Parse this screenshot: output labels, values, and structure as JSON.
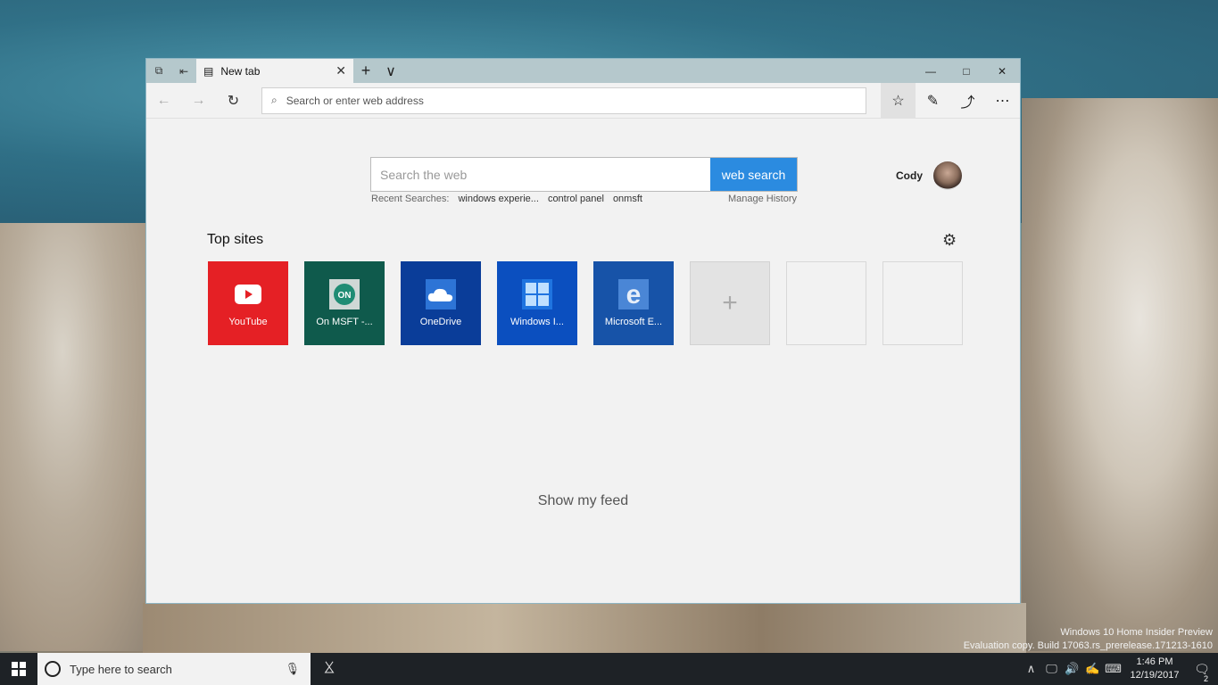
{
  "browser": {
    "tab_title": "New tab",
    "address_placeholder": "Search or enter web address"
  },
  "newtab": {
    "search_placeholder": "Search the web",
    "search_button": "web search",
    "recent_label": "Recent Searches:",
    "recent_items": [
      "windows experie...",
      "control panel",
      "onmsft"
    ],
    "manage_history": "Manage History",
    "user_name": "Cody",
    "topsites_heading": "Top sites",
    "tiles": [
      {
        "label": "YouTube",
        "color": "#e52025",
        "icon": "youtube-icon"
      },
      {
        "label": "On MSFT -...",
        "color": "#0f5a4c",
        "icon": "onmsft-icon"
      },
      {
        "label": "OneDrive",
        "color": "#0a3d99",
        "icon": "onedrive-icon"
      },
      {
        "label": "Windows I...",
        "color": "#0b4fbf",
        "icon": "windows-icon"
      },
      {
        "label": "Microsoft E...",
        "color": "#1753a8",
        "icon": "edge-icon"
      }
    ],
    "show_feed": "Show my feed"
  },
  "watermark": {
    "line1": "Windows 10 Home Insider Preview",
    "line2": "Evaluation copy. Build 17063.rs_prerelease.171213-1610"
  },
  "taskbar": {
    "search_placeholder": "Type here to search",
    "time": "1:46 PM",
    "date": "12/19/2017",
    "notification_count": "2"
  }
}
